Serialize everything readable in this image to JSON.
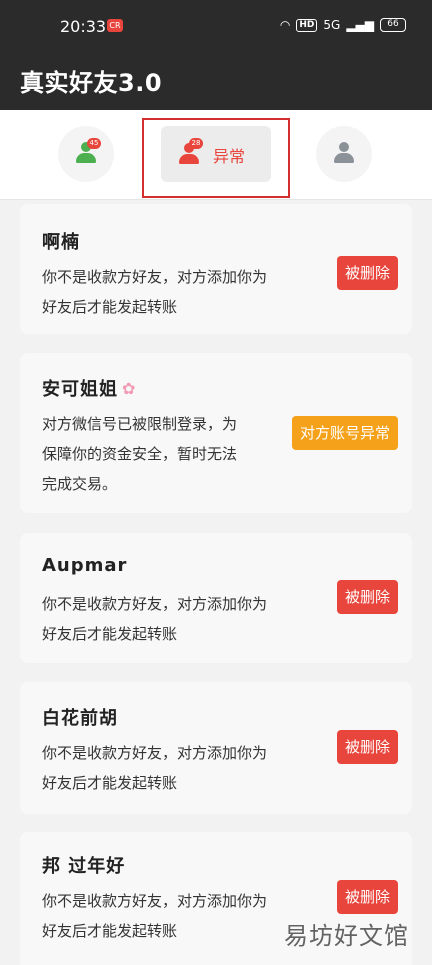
{
  "status": {
    "time": "20:33",
    "rec_label": "CR",
    "hd": "HD",
    "signal": "5G",
    "battery": "66"
  },
  "appbar": {
    "title": "真实好友3.0"
  },
  "tabs": [
    {
      "badge": "45"
    },
    {
      "badge": "28",
      "label": "异常"
    },
    {
      "badge": ""
    }
  ],
  "cards": [
    {
      "name": "啊楠",
      "message": "你不是收款方好友，对方添加你为\n好友后才能发起转账",
      "action": "被删除"
    },
    {
      "name": "安可姐姐",
      "message": "对方微信号已被限制登录，为\n保障你的资金安全，暂时无法\n完成交易。",
      "action": "对方账号异常"
    },
    {
      "name": "Aupmar",
      "message": "你不是收款方好友，对方添加你为\n好友后才能发起转账",
      "action": "被删除"
    },
    {
      "name": "白花前胡",
      "message": "你不是收款方好友，对方添加你为\n好友后才能发起转账",
      "action": "被删除"
    },
    {
      "name": "邦 过年好",
      "message": "你不是收款方好友，对方添加你为\n好友后才能发起转账",
      "action": "被删除"
    }
  ],
  "watermark": "易坊好文馆",
  "colors": {
    "accent": "#e8453c",
    "warning": "#f5a11a",
    "ok": "#4caf50",
    "appbar": "#2b2b2b"
  }
}
